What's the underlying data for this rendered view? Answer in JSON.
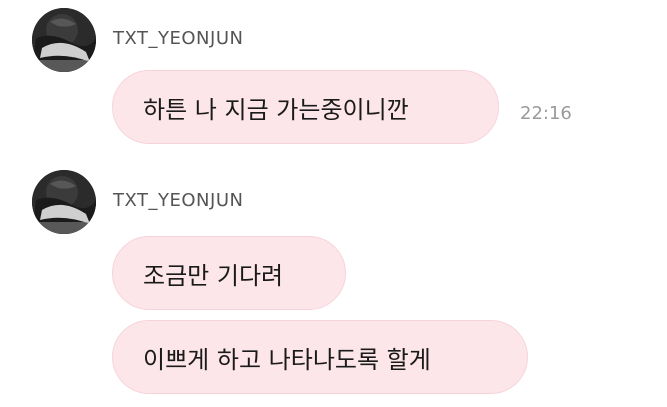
{
  "messages": [
    {
      "sender": "TXT_YEONJUN",
      "avatar_icon": "profile-photo-icon",
      "bubbles": [
        {
          "text": "하튼 나 지금 가는중이니깐",
          "time": "22:16"
        }
      ]
    },
    {
      "sender": "TXT_YEONJUN",
      "avatar_icon": "profile-photo-icon",
      "bubbles": [
        {
          "text": "조금만 기다려"
        },
        {
          "text": "이쁘게 하고 나타나도록 할게"
        }
      ]
    }
  ],
  "colors": {
    "bubble_background": "#fde6ea",
    "bubble_border": "#f7d4db",
    "sender_text": "#555555",
    "time_text": "#9a9a9a"
  }
}
